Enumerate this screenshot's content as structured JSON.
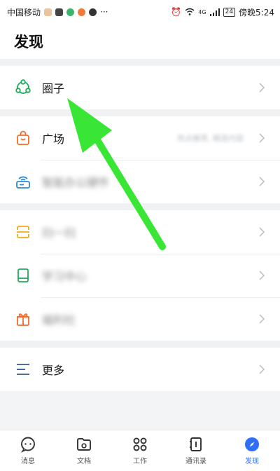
{
  "status": {
    "carrier": "中国移动",
    "dots": "···",
    "net": "4G",
    "battery": "24",
    "time": "傍晚5:24"
  },
  "header": {
    "title": "发现"
  },
  "menu": {
    "group1": [
      {
        "label": "圈子"
      }
    ],
    "group2": [
      {
        "label": "广场",
        "sub": "热点推荐, 精选内容"
      },
      {
        "label": "智能办公硬件"
      }
    ],
    "group3": [
      {
        "label": "扫一扫"
      },
      {
        "label": "学习中心"
      },
      {
        "label": "福利社"
      }
    ],
    "group4": [
      {
        "label": "更多"
      }
    ]
  },
  "tabs": [
    {
      "label": "消息"
    },
    {
      "label": "文档"
    },
    {
      "label": "工作"
    },
    {
      "label": "通讯录"
    },
    {
      "label": "发现"
    }
  ],
  "colors": {
    "accent": "#2f6ef6",
    "green": "#1faa5a",
    "orange": "#f36b2b",
    "blue": "#2a8bd8",
    "yellow": "#f2a81d",
    "arrow": "#39e635"
  }
}
